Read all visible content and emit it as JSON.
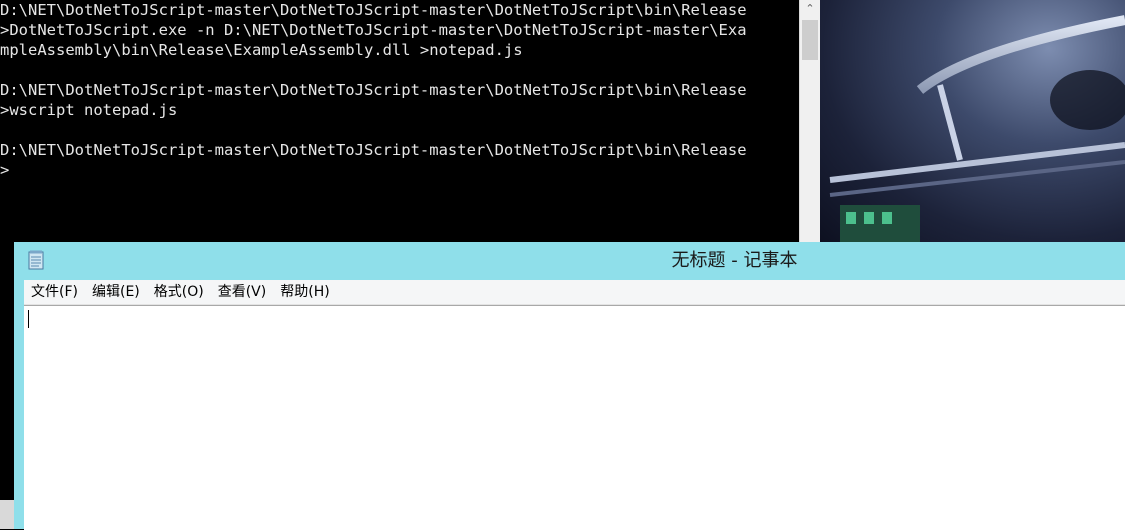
{
  "console": {
    "first_line": "D:\\NET\\DotNetToJScript-master\\DotNetToJScript-master\\DotNetToJScript\\bin\\Release",
    "lines": [
      ">DotNetToJScript.exe -n D:\\NET\\DotNetToJScript-master\\DotNetToJScript-master\\Exa",
      "mpleAssembly\\bin\\Release\\ExampleAssembly.dll >notepad.js",
      "",
      "D:\\NET\\DotNetToJScript-master\\DotNetToJScript-master\\DotNetToJScript\\bin\\Release",
      ">wscript notepad.js",
      "",
      "D:\\NET\\DotNetToJScript-master\\DotNetToJScript-master\\DotNetToJScript\\bin\\Release",
      ">"
    ],
    "scroll_up_glyph": "⌃"
  },
  "notepad": {
    "title": "无标题 - 记事本",
    "icon": "notepad-icon",
    "menu": [
      "文件(F)",
      "编辑(E)",
      "格式(O)",
      "查看(V)",
      "帮助(H)"
    ],
    "content": ""
  },
  "colors": {
    "titlebar": "#8fdfea",
    "console_bg": "#000000",
    "console_text": "#e6e6e6"
  }
}
